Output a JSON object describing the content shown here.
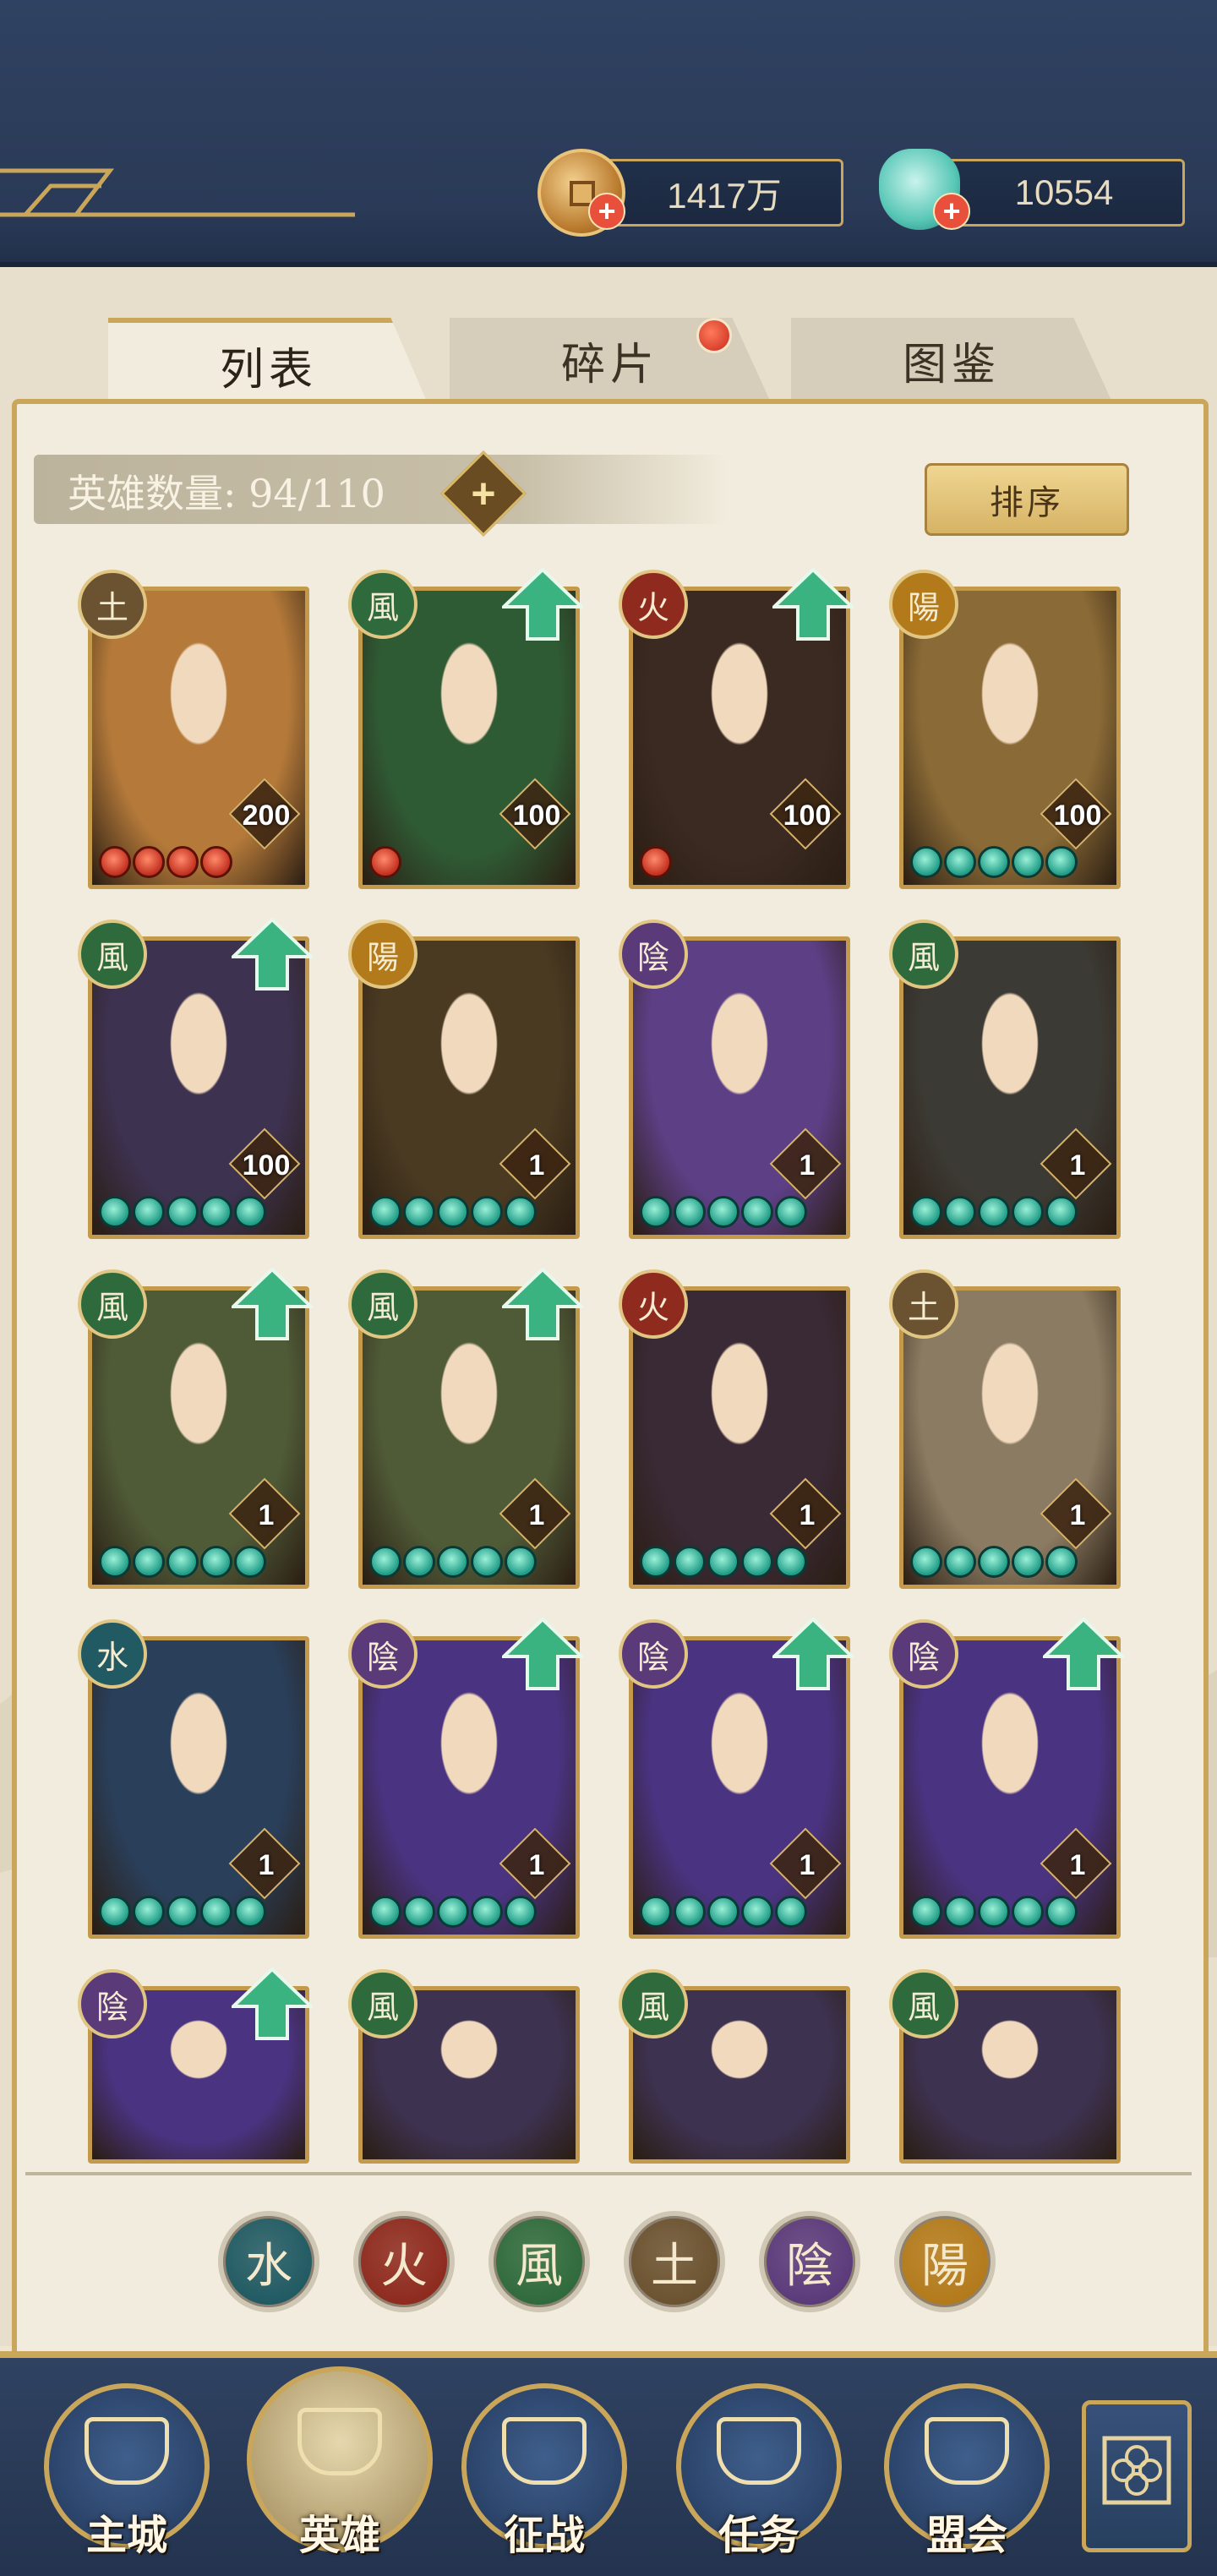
{
  "currencies": {
    "copper": {
      "icon": "copper-coin-icon",
      "value": "1417万"
    },
    "jade": {
      "icon": "jade-shell-icon",
      "value": "10554"
    }
  },
  "tabs": [
    {
      "label": "列表",
      "active": true
    },
    {
      "label": "碎片",
      "active": false,
      "has_dot": true
    },
    {
      "label": "图鉴",
      "active": false
    }
  ],
  "hero_count": {
    "label": "英雄数量: 94/110"
  },
  "sort_button": {
    "label": "排序"
  },
  "colors": {
    "gold": "#c9a65a",
    "navy": "#2a3a57",
    "earth": "#6b5230",
    "wind": "#2f6a3c",
    "fire": "#8e2a1e",
    "water": "#215a63",
    "yin": "#5b3a7a",
    "yang": "#b37a1b"
  },
  "heroes": [
    {
      "element": "土",
      "level": "200",
      "stars": 4,
      "star_type": "red",
      "upgrade": false,
      "portrait": "#b57a3a"
    },
    {
      "element": "風",
      "level": "100",
      "stars": 1,
      "star_type": "red",
      "upgrade": true,
      "portrait": "#2f5b34"
    },
    {
      "element": "火",
      "level": "100",
      "stars": 1,
      "star_type": "red",
      "upgrade": true,
      "portrait": "#3b2a22"
    },
    {
      "element": "陽",
      "level": "100",
      "stars": 5,
      "star_type": "green",
      "upgrade": false,
      "portrait": "#8a6a36"
    },
    {
      "element": "風",
      "level": "100",
      "stars": 5,
      "star_type": "green",
      "upgrade": true,
      "portrait": "#3d3250"
    },
    {
      "element": "陽",
      "level": "1",
      "stars": 5,
      "star_type": "green",
      "upgrade": false,
      "portrait": "#4a3a22"
    },
    {
      "element": "陰",
      "level": "1",
      "stars": 5,
      "star_type": "green",
      "upgrade": false,
      "portrait": "#5d3f86"
    },
    {
      "element": "風",
      "level": "1",
      "stars": 5,
      "star_type": "green",
      "upgrade": false,
      "portrait": "#3c3a34"
    },
    {
      "element": "風",
      "level": "1",
      "stars": 5,
      "star_type": "green",
      "upgrade": true,
      "portrait": "#4f5a37"
    },
    {
      "element": "風",
      "level": "1",
      "stars": 5,
      "star_type": "green",
      "upgrade": true,
      "portrait": "#4f5a37"
    },
    {
      "element": "火",
      "level": "1",
      "stars": 5,
      "star_type": "green",
      "upgrade": false,
      "portrait": "#3a2a36"
    },
    {
      "element": "土",
      "level": "1",
      "stars": 5,
      "star_type": "green",
      "upgrade": false,
      "portrait": "#8b7b62"
    },
    {
      "element": "水",
      "level": "1",
      "stars": 5,
      "star_type": "green",
      "upgrade": false,
      "portrait": "#2a3f5a"
    },
    {
      "element": "陰",
      "level": "1",
      "stars": 5,
      "star_type": "green",
      "upgrade": true,
      "portrait": "#4a3380"
    },
    {
      "element": "陰",
      "level": "1",
      "stars": 5,
      "star_type": "green",
      "upgrade": true,
      "portrait": "#4a3380"
    },
    {
      "element": "陰",
      "level": "1",
      "stars": 5,
      "star_type": "green",
      "upgrade": true,
      "portrait": "#4a3380"
    },
    {
      "element": "陰",
      "level": "",
      "stars": 0,
      "star_type": "green",
      "upgrade": true,
      "portrait": "#4a3380"
    },
    {
      "element": "風",
      "level": "",
      "stars": 0,
      "star_type": "green",
      "upgrade": false,
      "portrait": "#3d3250"
    },
    {
      "element": "風",
      "level": "",
      "stars": 0,
      "star_type": "green",
      "upgrade": false,
      "portrait": "#3d3250"
    },
    {
      "element": "風",
      "level": "",
      "stars": 0,
      "star_type": "green",
      "upgrade": false,
      "portrait": "#3d3250"
    }
  ],
  "element_filters": [
    {
      "label": "水",
      "color": "#215a63"
    },
    {
      "label": "火",
      "color": "#8e2a1e"
    },
    {
      "label": "風",
      "color": "#2f6a3c"
    },
    {
      "label": "土",
      "color": "#6b5230"
    },
    {
      "label": "陰",
      "color": "#5b3a7a"
    },
    {
      "label": "陽",
      "color": "#b37a1b"
    }
  ],
  "nav": [
    {
      "label": "主城",
      "icon": "city-gate-icon",
      "active": false
    },
    {
      "label": "英雄",
      "icon": "hero-portrait-icon",
      "active": true
    },
    {
      "label": "征战",
      "icon": "battle-drum-icon",
      "active": false
    },
    {
      "label": "任务",
      "icon": "scroll-icon",
      "active": false
    },
    {
      "label": "盟会",
      "icon": "guild-hall-icon",
      "active": false
    }
  ],
  "nav_extra": {
    "icon": "flower-menu-icon"
  }
}
